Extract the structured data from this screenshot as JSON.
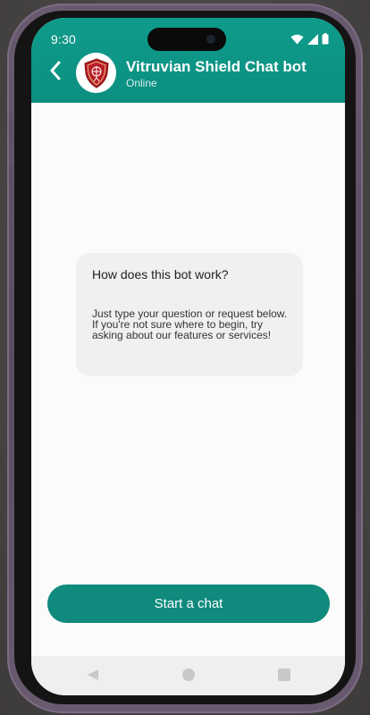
{
  "status_bar": {
    "time": "9:30",
    "icons": [
      "wifi-icon",
      "signal-icon",
      "battery-icon"
    ]
  },
  "header": {
    "back_icon": "chevron-left-icon",
    "bot_name": "Vitruvian Shield Chat bot",
    "bot_status": "Online",
    "avatar_icon": "shield-logo-icon"
  },
  "info_card": {
    "title": "How does this bot work?",
    "body": "Just type your question or request below.\n If you're not sure where to begin, try\nasking about our features or services!"
  },
  "start_chat": {
    "label": "Start a chat"
  },
  "nav_bar": {
    "icons": [
      "nav-back-icon",
      "nav-home-icon",
      "nav-recents-icon"
    ]
  },
  "colors": {
    "header": "#0f9b8b",
    "button": "#0f8a7c",
    "card": "#f0f0f0",
    "shield": "#b81e24"
  }
}
